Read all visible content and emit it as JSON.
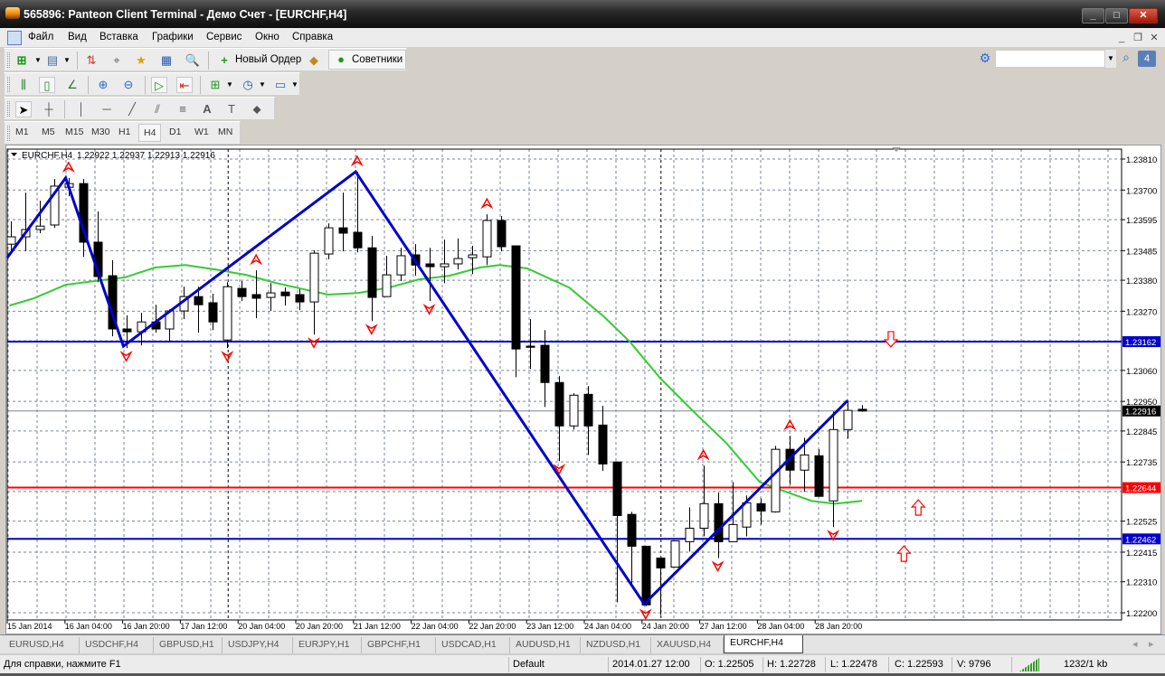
{
  "window": {
    "title": "565896: Panteon Client Terminal - Демо Счет - [EURCHF,H4]",
    "minimize": "_",
    "maximize": "□",
    "close": "✕"
  },
  "menu": {
    "items": [
      "Файл",
      "Вид",
      "Вставка",
      "Графики",
      "Сервис",
      "Окно",
      "Справка"
    ],
    "mdi_min": "_",
    "mdi_restore": "❐",
    "mdi_close": "✕"
  },
  "toolbar": {
    "new_order": "Новый Ордер",
    "experts": "Советники",
    "search_value": "",
    "notifications": "4"
  },
  "timeframes": {
    "items": [
      "M1",
      "M5",
      "M15",
      "M30",
      "H1",
      "H4",
      "D1",
      "W1",
      "MN"
    ],
    "active": "H4"
  },
  "chart_header": {
    "symbol": "EURCHF,H4",
    "ohlc": "1.22922 1.22937 1.22913 1.22916"
  },
  "colors": {
    "zigzag": "#0000cc",
    "ma": "#33cc33",
    "support_line": "#0000cc",
    "red_line": "#ff0000",
    "fractal": "#ff0000",
    "bid_label": "#000000"
  },
  "chart_data": {
    "type": "candlestick",
    "symbol": "EURCHF",
    "timeframe": "H4",
    "ylim": [
      1.222,
      1.2381
    ],
    "y_ticks": [
      "1.23810",
      "1.23700",
      "1.23595",
      "1.23485",
      "1.23380",
      "1.23270",
      "1.23060",
      "1.22950",
      "1.22845",
      "1.22735",
      "1.22525",
      "1.22415",
      "1.22310",
      "1.22200"
    ],
    "hidden_grid_levels": [
      1.23165,
      1.2263
    ],
    "x_ticks": [
      {
        "index": 0,
        "label": "15 Jan 2014"
      },
      {
        "index": 4,
        "label": "16 Jan 04:00"
      },
      {
        "index": 8,
        "label": "16 Jan 20:00"
      },
      {
        "index": 12,
        "label": "17 Jan 12:00"
      },
      {
        "index": 16,
        "label": "20 Jan 04:00"
      },
      {
        "index": 20,
        "label": "20 Jan 20:00"
      },
      {
        "index": 24,
        "label": "21 Jan 12:00"
      },
      {
        "index": 28,
        "label": "22 Jan 04:00"
      },
      {
        "index": 32,
        "label": "22 Jan 20:00"
      },
      {
        "index": 36,
        "label": "23 Jan 12:00"
      },
      {
        "index": 40,
        "label": "24 Jan 04:00"
      },
      {
        "index": 44,
        "label": "24 Jan 20:00"
      },
      {
        "index": 48,
        "label": "27 Jan 12:00"
      },
      {
        "index": 52,
        "label": "28 Jan 04:00"
      },
      {
        "index": 56,
        "label": "28 Jan 20:00"
      }
    ],
    "period_separators": [
      15,
      45
    ],
    "candles_ohlc": [
      [
        1.23508,
        1.23589,
        1.23476,
        1.23534
      ],
      [
        1.23534,
        1.23691,
        1.23483,
        1.2356
      ],
      [
        1.2356,
        1.23662,
        1.23547,
        1.23572
      ],
      [
        1.23576,
        1.23739,
        1.23566,
        1.23714
      ],
      [
        1.2371,
        1.23743,
        1.23678,
        1.23723
      ],
      [
        1.23723,
        1.23739,
        1.23463,
        1.23515
      ],
      [
        1.23515,
        1.23624,
        1.23373,
        1.23393
      ],
      [
        1.23396,
        1.23451,
        1.23181,
        1.23207
      ],
      [
        1.23207,
        1.23255,
        1.23139,
        1.23197
      ],
      [
        1.23197,
        1.23264,
        1.23149,
        1.23232
      ],
      [
        1.23232,
        1.23293,
        1.23194,
        1.23207
      ],
      [
        1.23207,
        1.23277,
        1.23162,
        1.23271
      ],
      [
        1.23271,
        1.23357,
        1.23242,
        1.23322
      ],
      [
        1.23322,
        1.23357,
        1.23194,
        1.23293
      ],
      [
        1.233,
        1.23332,
        1.23203,
        1.23232
      ],
      [
        1.23168,
        1.23373,
        1.23139,
        1.23357
      ],
      [
        1.23351,
        1.23377,
        1.23306,
        1.23322
      ],
      [
        1.23329,
        1.23415,
        1.23245,
        1.23316
      ],
      [
        1.23319,
        1.2337,
        1.23271,
        1.23335
      ],
      [
        1.23338,
        1.23354,
        1.2329,
        1.23325
      ],
      [
        1.23329,
        1.23348,
        1.23274,
        1.23303
      ],
      [
        1.23303,
        1.23486,
        1.23187,
        1.23476
      ],
      [
        1.23473,
        1.23582,
        1.23454,
        1.23566
      ],
      [
        1.23566,
        1.23691,
        1.23483,
        1.23547
      ],
      [
        1.2355,
        1.23765,
        1.23479,
        1.23495
      ],
      [
        1.23495,
        1.23537,
        1.23235,
        1.23319
      ],
      [
        1.23322,
        1.23467,
        1.23322,
        1.23399
      ],
      [
        1.23399,
        1.23495,
        1.23377,
        1.23467
      ],
      [
        1.2347,
        1.23508,
        1.23396,
        1.23434
      ],
      [
        1.23438,
        1.23495,
        1.23306,
        1.23428
      ],
      [
        1.23428,
        1.23524,
        1.2337,
        1.23438
      ],
      [
        1.23438,
        1.23528,
        1.23418,
        1.23457
      ],
      [
        1.2346,
        1.23502,
        1.23402,
        1.2347
      ],
      [
        1.23463,
        1.23614,
        1.23434,
        1.23592
      ],
      [
        1.23592,
        1.23608,
        1.23483,
        1.23499
      ],
      [
        1.23502,
        1.23502,
        1.23036,
        1.23136
      ],
      [
        1.23146,
        1.23242,
        1.23065,
        1.23142
      ],
      [
        1.23149,
        1.23203,
        1.2293,
        1.23017
      ],
      [
        1.23017,
        1.2304,
        1.22738,
        1.22863
      ],
      [
        1.22863,
        1.22979,
        1.2285,
        1.22972
      ],
      [
        1.22975,
        1.23004,
        1.2276,
        1.22863
      ],
      [
        1.22866,
        1.22934,
        1.22703,
        1.22728
      ],
      [
        1.22735,
        1.22735,
        1.22237,
        1.22545
      ],
      [
        1.22549,
        1.22558,
        1.22298,
        1.22436
      ],
      [
        1.22436,
        1.22436,
        1.22224,
        1.22228
      ],
      [
        1.22394,
        1.22394,
        1.22192,
        1.22359
      ],
      [
        1.22362,
        1.22455,
        1.22362,
        1.22455
      ],
      [
        1.22452,
        1.22574,
        1.22417,
        1.225
      ],
      [
        1.225,
        1.22722,
        1.22471,
        1.22587
      ],
      [
        1.22587,
        1.22626,
        1.22394,
        1.22452
      ],
      [
        1.22452,
        1.22664,
        1.22452,
        1.22513
      ],
      [
        1.22504,
        1.22616,
        1.22471,
        1.2259
      ],
      [
        1.22587,
        1.22606,
        1.22513,
        1.22561
      ],
      [
        1.22558,
        1.22792,
        1.22555,
        1.2278
      ],
      [
        1.2278,
        1.22828,
        1.22654,
        1.22706
      ],
      [
        1.22706,
        1.22821,
        1.22629,
        1.2276
      ],
      [
        1.22757,
        1.2278,
        1.22613,
        1.22613
      ],
      [
        1.22597,
        1.22914,
        1.22504,
        1.2285
      ],
      [
        1.2285,
        1.22953,
        1.22818,
        1.22918
      ],
      [
        1.22922,
        1.22937,
        1.22913,
        1.22916
      ]
    ],
    "moving_average": [
      [
        -0.1,
        1.2329
      ],
      [
        1.6,
        1.23316
      ],
      [
        3.8,
        1.23364
      ],
      [
        5.8,
        1.23377
      ],
      [
        7.9,
        1.2339
      ],
      [
        10,
        1.23425
      ],
      [
        12.1,
        1.23434
      ],
      [
        14.2,
        1.23418
      ],
      [
        16.3,
        1.23399
      ],
      [
        18.4,
        1.2337
      ],
      [
        20.3,
        1.23348
      ],
      [
        22,
        1.23329
      ],
      [
        24.1,
        1.23335
      ],
      [
        26.2,
        1.23354
      ],
      [
        28.3,
        1.23383
      ],
      [
        30.4,
        1.23396
      ],
      [
        32.5,
        1.23425
      ],
      [
        33.9,
        1.23434
      ],
      [
        35.8,
        1.23422
      ],
      [
        38.7,
        1.23354
      ],
      [
        41.1,
        1.23251
      ],
      [
        42.9,
        1.23162
      ],
      [
        45,
        1.23033
      ],
      [
        47.5,
        1.22905
      ],
      [
        49.6,
        1.22802
      ],
      [
        51.9,
        1.22664
      ],
      [
        53.4,
        1.22635
      ],
      [
        55.5,
        1.22597
      ],
      [
        57.1,
        1.22587
      ],
      [
        59,
        1.22597
      ]
    ],
    "zigzag": [
      [
        -0.25,
        1.2346
      ],
      [
        3.8,
        1.23743
      ],
      [
        7.8,
        1.23146
      ],
      [
        23.9,
        1.23765
      ],
      [
        43.9,
        1.22231
      ],
      [
        58,
        1.22953
      ]
    ],
    "fractals_up": [
      4,
      17,
      24,
      33,
      48,
      54
    ],
    "fractals_down": [
      8,
      15,
      21,
      25,
      29,
      38,
      44,
      49,
      57
    ],
    "signal_arrows": [
      {
        "dir": "down",
        "index": 61.0,
        "price": 1.23172
      },
      {
        "dir": "up",
        "index": 62.9,
        "price": 1.22572
      },
      {
        "dir": "up",
        "index": 61.9,
        "price": 1.22408
      }
    ],
    "hlines": [
      {
        "price": 1.23162,
        "label": "1.23162",
        "color": "#0000cc"
      },
      {
        "price": 1.22644,
        "label": "1.22644",
        "color": "#ff0000"
      },
      {
        "price": 1.22462,
        "label": "1.22462",
        "color": "#0000cc"
      }
    ],
    "bid": {
      "price": 1.22916,
      "label": "1.22916"
    }
  },
  "symbol_tabs": [
    "EURUSD,H4",
    "USDCHF,H4",
    "GBPUSD,H1",
    "USDJPY,H4",
    "EURJPY,H1",
    "GBPCHF,H1",
    "USDCAD,H1",
    "AUDUSD,H1",
    "NZDUSD,H1",
    "XAUUSD,H4",
    "EURCHF,H4"
  ],
  "tab_nav": {
    "prev": "◂",
    "next": "▸"
  },
  "status": {
    "help": "Для справки, нажмите F1",
    "profile": "Default",
    "datetime": "2014.01.27 12:00",
    "open": "O: 1.22505",
    "high": "H: 1.22728",
    "low": "L: 1.22478",
    "close": "C: 1.22593",
    "volume": "V: 9796",
    "traffic": "1232/1 kb"
  }
}
